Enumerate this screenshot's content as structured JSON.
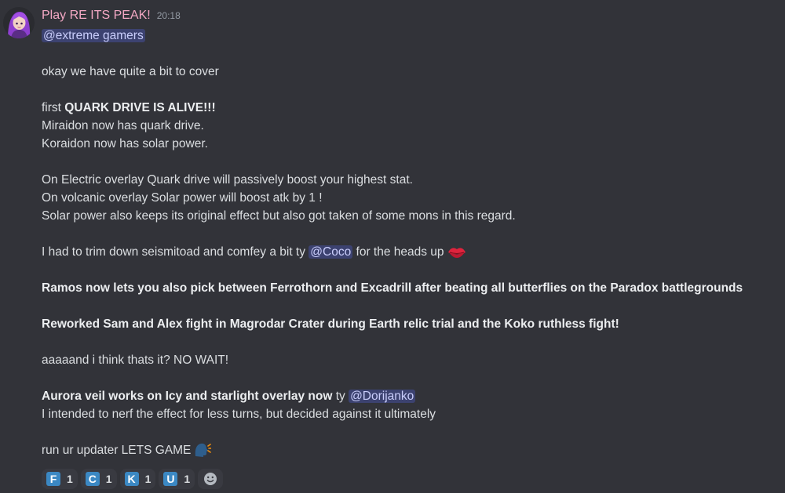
{
  "message": {
    "author": "Play RE ITS PEAK!",
    "timestamp": "20:18",
    "mention_role": "@extreme gamers",
    "lines": {
      "l1": "okay we have quite a bit to cover",
      "l2_prefix": "first ",
      "l2_bold": "QUARK DRIVE IS ALIVE!!!",
      "l3": "Miraidon now has quark drive.",
      "l4": "Koraidon now has solar power.",
      "l5": "On Electric overlay Quark drive will passively boost your highest stat.",
      "l6": "On volcanic overlay Solar power will boost atk by 1 !",
      "l7": "Solar power also keeps its original effect but also got taken of some mons in this regard.",
      "l8_prefix": "I had to trim down seismitoad and comfey a bit ty ",
      "l8_mention": "@Coco",
      "l8_suffix": " for the heads up",
      "l9": "Ramos now lets you also pick between Ferrothorn and Excadrill after beating all butterflies on the Paradox battlegrounds",
      "l10": "Reworked Sam and Alex fight in Magrodar Crater during Earth relic trial and the Koko ruthless fight!",
      "l11": "aaaaand i think thats it? NO WAIT!",
      "l12_bold": "Aurora veil works on Icy and starlight overlay now",
      "l12_mid": " ty ",
      "l12_mention": "@Dorijanko",
      "l13": "I intended to nerf the effect for less turns, but decided against it ultimately",
      "l14": "run ur updater LETS GAME"
    },
    "emojis": {
      "kiss": "kiss-lips-icon",
      "speaking": "speaking-head-icon"
    }
  },
  "reactions": [
    {
      "letter": "F",
      "count": "1",
      "icon": "regional-indicator-f"
    },
    {
      "letter": "C",
      "count": "1",
      "icon": "regional-indicator-c"
    },
    {
      "letter": "K",
      "count": "1",
      "icon": "regional-indicator-k"
    },
    {
      "letter": "U",
      "count": "1",
      "icon": "regional-indicator-u"
    }
  ],
  "add_reaction_icon": "smiley-add-reaction-icon",
  "colors": {
    "background": "#323339",
    "username": "#f3a8c4",
    "mention_bg": "#3c4270",
    "mention_text": "#c9cdfb",
    "keycap": "#3b88c3"
  }
}
